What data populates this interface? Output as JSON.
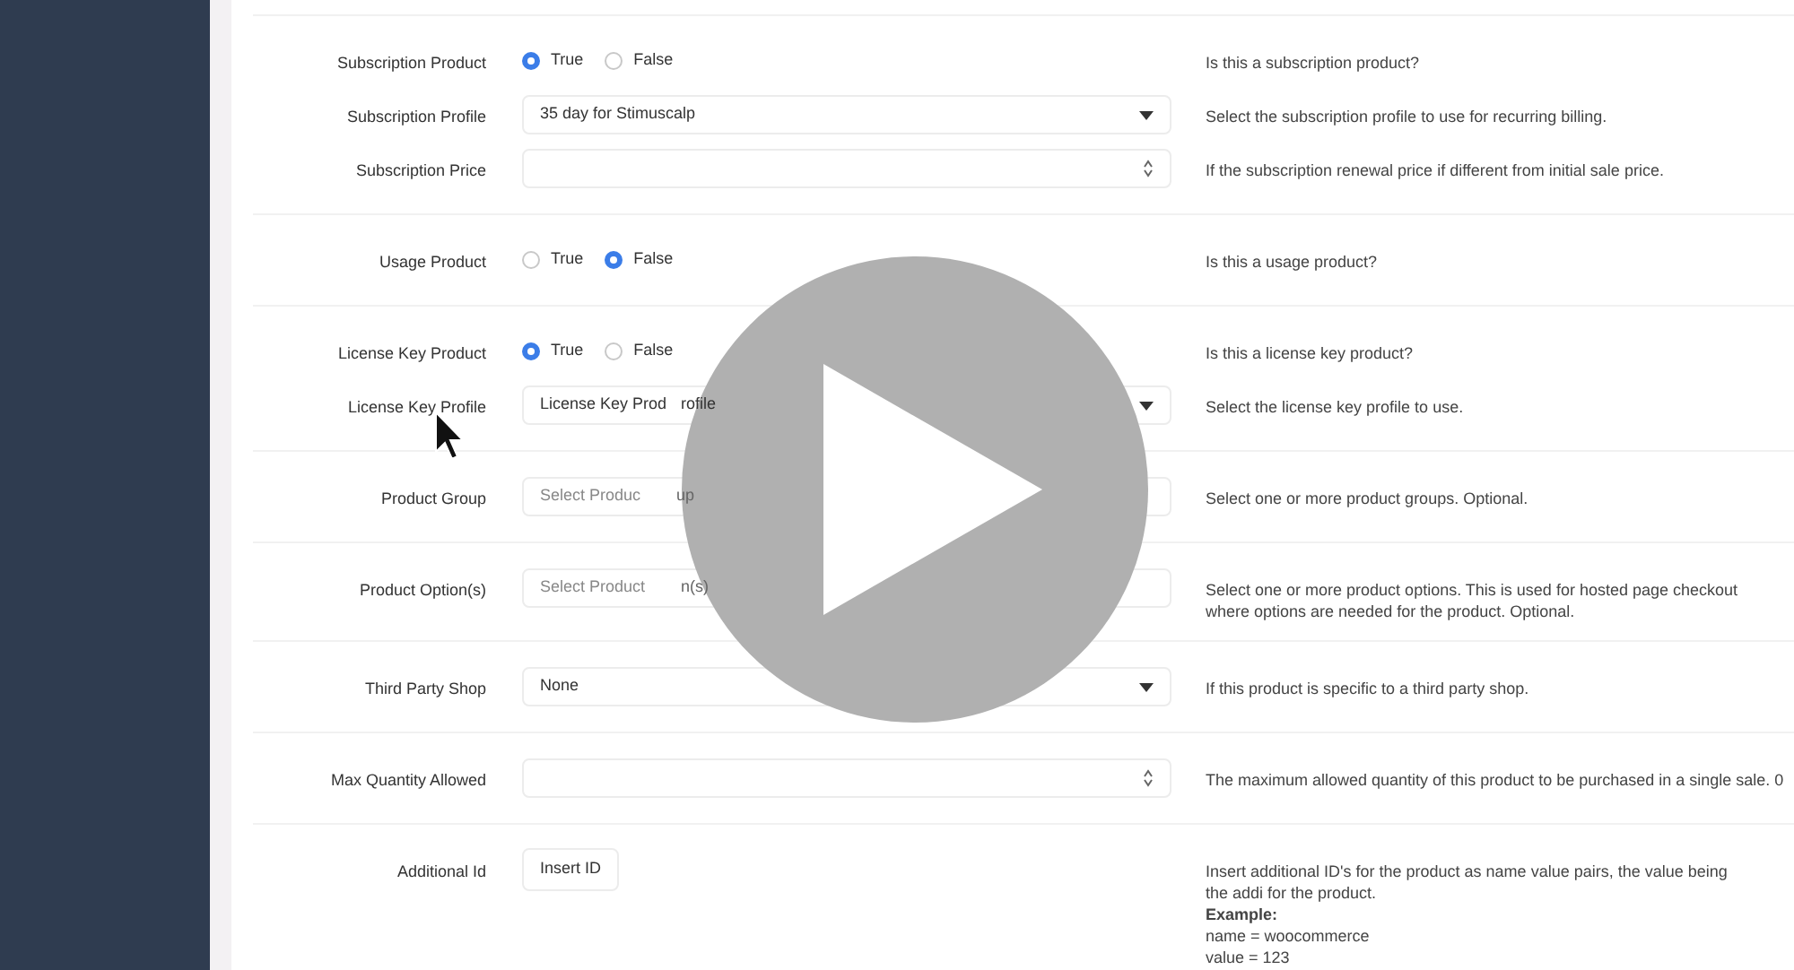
{
  "sections": [
    {
      "rows": [
        {
          "kind": "radio",
          "label": "Subscription Product",
          "options": [
            {
              "label": "True",
              "selected": true
            },
            {
              "label": "False",
              "selected": false
            }
          ],
          "help": "Is this a subscription product?"
        },
        {
          "kind": "select",
          "label": "Subscription Profile",
          "value": "35 day for Stimuscalp",
          "help": "Select the subscription profile to use for recurring billing."
        },
        {
          "kind": "number",
          "label": "Subscription Price",
          "help": "If the subscription renewal price if different from initial sale price."
        }
      ]
    },
    {
      "rows": [
        {
          "kind": "radio",
          "label": "Usage Product",
          "options": [
            {
              "label": "True",
              "selected": false
            },
            {
              "label": "False",
              "selected": true
            }
          ],
          "help": "Is this a usage product?"
        }
      ]
    },
    {
      "rows": [
        {
          "kind": "radio",
          "label": "License Key Product",
          "options": [
            {
              "label": "True",
              "selected": true
            },
            {
              "label": "False",
              "selected": false
            }
          ],
          "help": "Is this a license key product?"
        },
        {
          "kind": "select",
          "label": "License Key Profile",
          "value": "License Key Prod",
          "value_tail": "rofile",
          "help": "Select the license key profile to use."
        }
      ]
    },
    {
      "rows": [
        {
          "kind": "multiselect",
          "label": "Product Group",
          "placeholder": "Select Produc",
          "placeholder_tail": "up",
          "help": "Select one or more product groups. Optional."
        }
      ]
    },
    {
      "rows": [
        {
          "kind": "multiselect",
          "label": "Product Option(s)",
          "placeholder": "Select Product",
          "placeholder_tail": "n(s)",
          "help": "Select one or more product options. This is used for hosted page checkout where options are needed for the product. Optional."
        }
      ]
    },
    {
      "rows": [
        {
          "kind": "select",
          "label": "Third Party Shop",
          "value": "None",
          "help": "If this product is specific to a third party shop."
        }
      ]
    },
    {
      "rows": [
        {
          "kind": "number",
          "label": "Max Quantity Allowed",
          "help": "The maximum allowed quantity of this product to be purchased in a single sale. 0"
        }
      ]
    },
    {
      "rows": [
        {
          "kind": "button",
          "label": "Additional Id",
          "button": "Insert ID",
          "help": "Insert additional ID's for the product as name value pairs, the value being the addi for the product.",
          "example_title": "Example:",
          "example_lines": [
            "name = woocommerce",
            "value = 123"
          ]
        }
      ]
    }
  ]
}
